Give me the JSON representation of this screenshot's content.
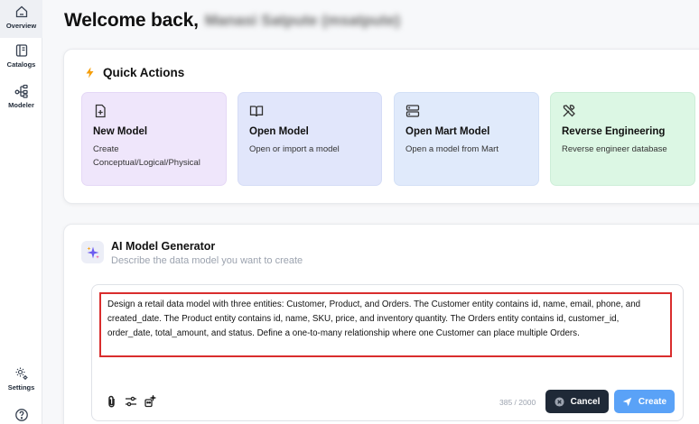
{
  "sidebar": {
    "items": [
      {
        "label": "Overview",
        "icon": "home-icon",
        "active": true
      },
      {
        "label": "Catalogs",
        "icon": "book-icon"
      },
      {
        "label": "Modeler",
        "icon": "diagram-icon"
      },
      {
        "label": "Settings",
        "icon": "gear-icon"
      },
      {
        "label": "",
        "icon": "help-icon"
      }
    ]
  },
  "header": {
    "welcome": "Welcome back,",
    "username": "Manasi Satpute (msatpute)"
  },
  "quick_actions": {
    "title": "Quick Actions",
    "tiles": [
      {
        "title": "New Model",
        "desc": "Create Conceptual/Logical/Physical",
        "icon": "file-plus-icon",
        "color": "#efe6fb"
      },
      {
        "title": "Open Model",
        "desc": "Open or import a model",
        "icon": "open-book-icon",
        "color": "#e1e6fb"
      },
      {
        "title": "Open Mart Model",
        "desc": "Open a model from Mart",
        "icon": "server-icon",
        "color": "#e0eafb"
      },
      {
        "title": "Reverse Engineering",
        "desc": "Reverse engineer database",
        "icon": "tools-icon",
        "color": "#dcf7e4"
      }
    ]
  },
  "ai_generator": {
    "title": "AI Model Generator",
    "subtitle": "Describe the data model you want to create",
    "prompt": "Design a retail data model with three entities: Customer, Product, and Orders. The Customer entity contains id, name, email, phone, and created_date. The Product entity contains id, name, SKU, price, and inventory quantity. The Orders entity contains id, customer_id, order_date, total_amount, and status. Define a one-to-many relationship where one Customer can place multiple Orders.",
    "counter": "385 / 2000",
    "cancel_label": "Cancel",
    "create_label": "Create"
  },
  "colors": {
    "accent_create": "#5aa2f7",
    "cancel_bg": "#1f2937",
    "highlight_border": "#d92d2d",
    "bolt": "#f59e0b"
  }
}
